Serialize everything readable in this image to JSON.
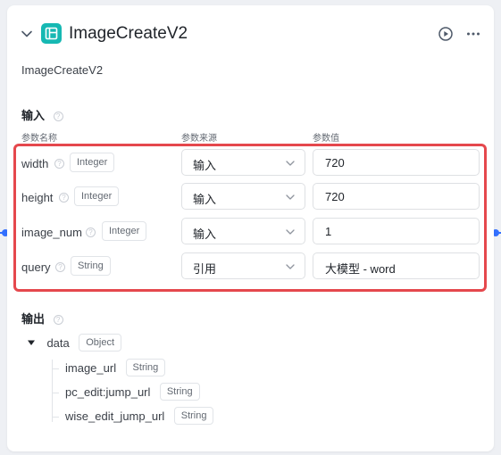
{
  "node": {
    "title": "ImageCreateV2",
    "description": "ImageCreateV2",
    "icons": {
      "collapse": "chevron-down-icon",
      "app": "app-layout-icon",
      "run": "play-circle-icon",
      "more": "more-dots-icon"
    },
    "accent_color": "#16b8b3",
    "highlight_color": "#e5484d"
  },
  "input": {
    "title": "输入",
    "columns": {
      "name": "参数名称",
      "source": "参数来源",
      "value": "参数值"
    },
    "params": [
      {
        "name": "width",
        "type": "Integer",
        "source": "输入",
        "value": "720"
      },
      {
        "name": "height",
        "type": "Integer",
        "source": "输入",
        "value": "720"
      },
      {
        "name": "image_num",
        "type": "Integer",
        "source": "输入",
        "value": "1"
      },
      {
        "name": "query",
        "type": "String",
        "source": "引用",
        "value": "大模型 - word"
      }
    ]
  },
  "output": {
    "title": "输出",
    "root": {
      "name": "data",
      "type": "Object"
    },
    "children": [
      {
        "name": "image_url",
        "type": "String"
      },
      {
        "name": "pc_edit:jump_url",
        "type": "String"
      },
      {
        "name": "wise_edit_jump_url",
        "type": "String"
      }
    ]
  }
}
